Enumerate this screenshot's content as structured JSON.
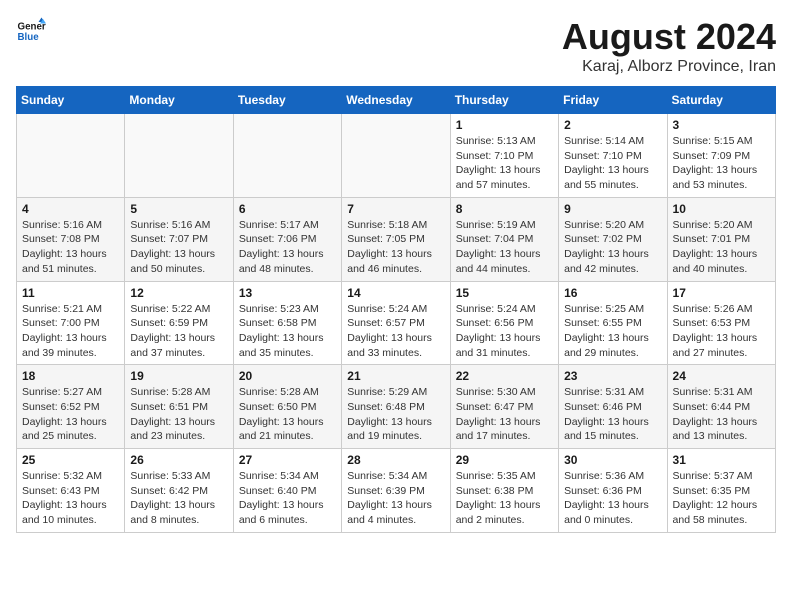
{
  "header": {
    "logo_line1": "General",
    "logo_line2": "Blue",
    "month": "August 2024",
    "location": "Karaj, Alborz Province, Iran"
  },
  "weekdays": [
    "Sunday",
    "Monday",
    "Tuesday",
    "Wednesday",
    "Thursday",
    "Friday",
    "Saturday"
  ],
  "weeks": [
    [
      {
        "day": "",
        "info": ""
      },
      {
        "day": "",
        "info": ""
      },
      {
        "day": "",
        "info": ""
      },
      {
        "day": "",
        "info": ""
      },
      {
        "day": "1",
        "info": "Sunrise: 5:13 AM\nSunset: 7:10 PM\nDaylight: 13 hours\nand 57 minutes."
      },
      {
        "day": "2",
        "info": "Sunrise: 5:14 AM\nSunset: 7:10 PM\nDaylight: 13 hours\nand 55 minutes."
      },
      {
        "day": "3",
        "info": "Sunrise: 5:15 AM\nSunset: 7:09 PM\nDaylight: 13 hours\nand 53 minutes."
      }
    ],
    [
      {
        "day": "4",
        "info": "Sunrise: 5:16 AM\nSunset: 7:08 PM\nDaylight: 13 hours\nand 51 minutes."
      },
      {
        "day": "5",
        "info": "Sunrise: 5:16 AM\nSunset: 7:07 PM\nDaylight: 13 hours\nand 50 minutes."
      },
      {
        "day": "6",
        "info": "Sunrise: 5:17 AM\nSunset: 7:06 PM\nDaylight: 13 hours\nand 48 minutes."
      },
      {
        "day": "7",
        "info": "Sunrise: 5:18 AM\nSunset: 7:05 PM\nDaylight: 13 hours\nand 46 minutes."
      },
      {
        "day": "8",
        "info": "Sunrise: 5:19 AM\nSunset: 7:04 PM\nDaylight: 13 hours\nand 44 minutes."
      },
      {
        "day": "9",
        "info": "Sunrise: 5:20 AM\nSunset: 7:02 PM\nDaylight: 13 hours\nand 42 minutes."
      },
      {
        "day": "10",
        "info": "Sunrise: 5:20 AM\nSunset: 7:01 PM\nDaylight: 13 hours\nand 40 minutes."
      }
    ],
    [
      {
        "day": "11",
        "info": "Sunrise: 5:21 AM\nSunset: 7:00 PM\nDaylight: 13 hours\nand 39 minutes."
      },
      {
        "day": "12",
        "info": "Sunrise: 5:22 AM\nSunset: 6:59 PM\nDaylight: 13 hours\nand 37 minutes."
      },
      {
        "day": "13",
        "info": "Sunrise: 5:23 AM\nSunset: 6:58 PM\nDaylight: 13 hours\nand 35 minutes."
      },
      {
        "day": "14",
        "info": "Sunrise: 5:24 AM\nSunset: 6:57 PM\nDaylight: 13 hours\nand 33 minutes."
      },
      {
        "day": "15",
        "info": "Sunrise: 5:24 AM\nSunset: 6:56 PM\nDaylight: 13 hours\nand 31 minutes."
      },
      {
        "day": "16",
        "info": "Sunrise: 5:25 AM\nSunset: 6:55 PM\nDaylight: 13 hours\nand 29 minutes."
      },
      {
        "day": "17",
        "info": "Sunrise: 5:26 AM\nSunset: 6:53 PM\nDaylight: 13 hours\nand 27 minutes."
      }
    ],
    [
      {
        "day": "18",
        "info": "Sunrise: 5:27 AM\nSunset: 6:52 PM\nDaylight: 13 hours\nand 25 minutes."
      },
      {
        "day": "19",
        "info": "Sunrise: 5:28 AM\nSunset: 6:51 PM\nDaylight: 13 hours\nand 23 minutes."
      },
      {
        "day": "20",
        "info": "Sunrise: 5:28 AM\nSunset: 6:50 PM\nDaylight: 13 hours\nand 21 minutes."
      },
      {
        "day": "21",
        "info": "Sunrise: 5:29 AM\nSunset: 6:48 PM\nDaylight: 13 hours\nand 19 minutes."
      },
      {
        "day": "22",
        "info": "Sunrise: 5:30 AM\nSunset: 6:47 PM\nDaylight: 13 hours\nand 17 minutes."
      },
      {
        "day": "23",
        "info": "Sunrise: 5:31 AM\nSunset: 6:46 PM\nDaylight: 13 hours\nand 15 minutes."
      },
      {
        "day": "24",
        "info": "Sunrise: 5:31 AM\nSunset: 6:44 PM\nDaylight: 13 hours\nand 13 minutes."
      }
    ],
    [
      {
        "day": "25",
        "info": "Sunrise: 5:32 AM\nSunset: 6:43 PM\nDaylight: 13 hours\nand 10 minutes."
      },
      {
        "day": "26",
        "info": "Sunrise: 5:33 AM\nSunset: 6:42 PM\nDaylight: 13 hours\nand 8 minutes."
      },
      {
        "day": "27",
        "info": "Sunrise: 5:34 AM\nSunset: 6:40 PM\nDaylight: 13 hours\nand 6 minutes."
      },
      {
        "day": "28",
        "info": "Sunrise: 5:34 AM\nSunset: 6:39 PM\nDaylight: 13 hours\nand 4 minutes."
      },
      {
        "day": "29",
        "info": "Sunrise: 5:35 AM\nSunset: 6:38 PM\nDaylight: 13 hours\nand 2 minutes."
      },
      {
        "day": "30",
        "info": "Sunrise: 5:36 AM\nSunset: 6:36 PM\nDaylight: 13 hours\nand 0 minutes."
      },
      {
        "day": "31",
        "info": "Sunrise: 5:37 AM\nSunset: 6:35 PM\nDaylight: 12 hours\nand 58 minutes."
      }
    ]
  ]
}
